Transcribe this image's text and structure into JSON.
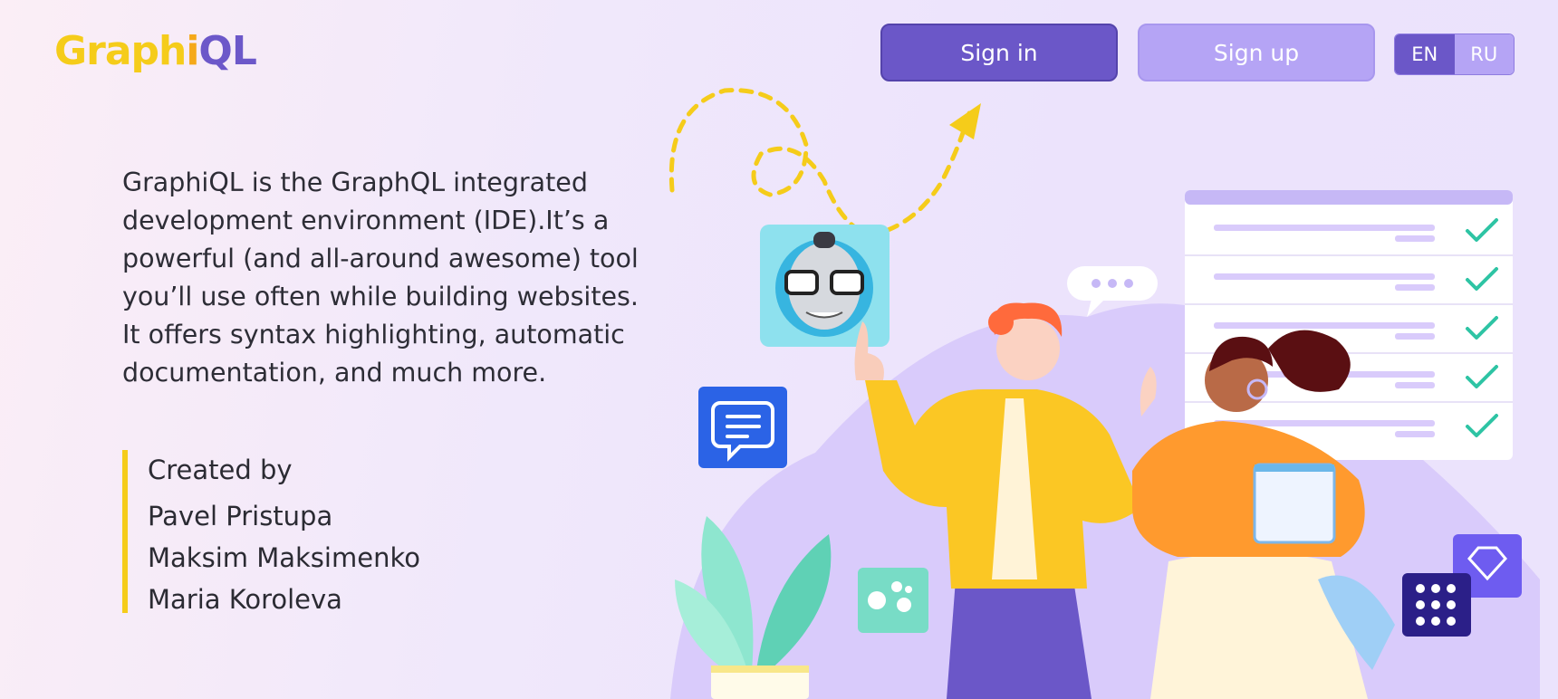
{
  "header": {
    "logo": {
      "part1": "Graph",
      "i": "i",
      "part2": "QL"
    },
    "sign_in_label": "Sign in",
    "sign_up_label": "Sign up",
    "languages": [
      "EN",
      "RU"
    ],
    "active_language": "EN"
  },
  "main": {
    "description": "GraphiQL is the GraphQL integrated development environment (IDE).It’s a powerful (and all-around awesome) tool you’ll use often while building websites. It offers syntax highlighting, automatic documentation, and much more.",
    "credits": {
      "title": "Created by",
      "names": [
        "Pavel Pristupa",
        "Maksim Maksimenko",
        "Maria Koroleva"
      ]
    }
  },
  "illustration": {
    "icons": [
      "robot-avatar-icon",
      "chat-icon",
      "checklist-icon",
      "dots-icon",
      "gem-icon",
      "speech-bubble-icon"
    ]
  },
  "colors": {
    "accent": "#6b57c8",
    "accent_light": "#b5a4f5",
    "logo_yellow": "#f5cc1a",
    "credits_bar": "#f5cc1a"
  }
}
